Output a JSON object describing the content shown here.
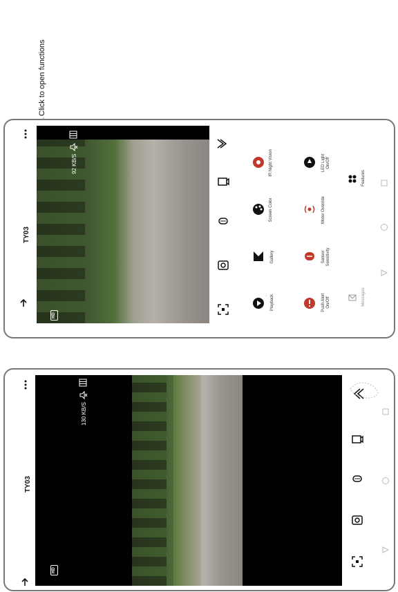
{
  "caption": "Click to open functions",
  "colors": {
    "accent_red": "#c0392b",
    "frame": "#777777"
  },
  "left_screen": {
    "title": "TY03",
    "hd_label": "HD",
    "speed": "130 KB/S",
    "icons": [
      "back-arrow-icon",
      "more-icon",
      "mute-icon",
      "list-icon",
      "fullscreen-icon",
      "camera-icon",
      "microphone-icon",
      "record-icon",
      "expand-icon"
    ]
  },
  "right_screen": {
    "title": "TY03",
    "hd_label": "HD",
    "speed": "92 KB/S",
    "features": [
      {
        "label": "Playback",
        "icon": "playback-icon"
      },
      {
        "label": "Gallery",
        "icon": "gallery-icon"
      },
      {
        "label": "Screen Color",
        "icon": "palette-icon"
      },
      {
        "label": "IR Night Vision",
        "icon": "ir-night-vision-icon"
      },
      {
        "label": "Push Alert On/Off",
        "icon": "push-alert-icon"
      },
      {
        "label": "Sensor Sensitivity",
        "icon": "sensor-sensitivity-icon"
      },
      {
        "label": "Motor Override",
        "icon": "motor-override-icon"
      },
      {
        "label": "LED Light On/Off",
        "icon": "led-light-icon"
      }
    ],
    "bottom_tabs": [
      {
        "label": "Messages",
        "icon": "messages-icon"
      },
      {
        "label": "Features",
        "icon": "features-icon"
      }
    ]
  }
}
